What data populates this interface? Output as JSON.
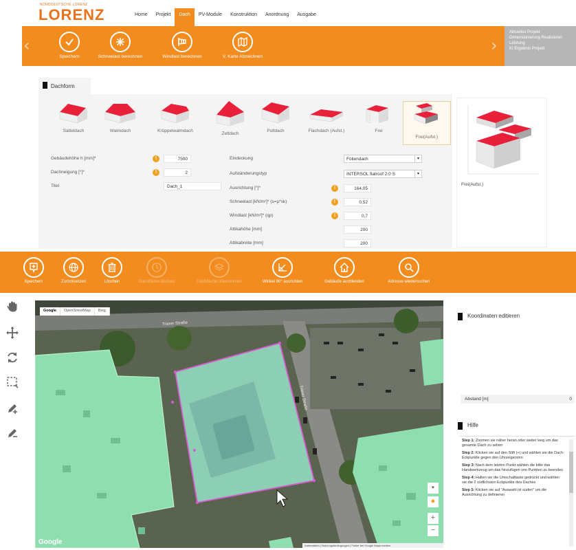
{
  "header": {
    "logo_small": "NORDDEUTSCHE LORENZ",
    "logo": "LORENZ",
    "nav": [
      {
        "label": "Home",
        "active": false
      },
      {
        "label": "Projekt",
        "active": false
      },
      {
        "label": "Dach",
        "active": true
      },
      {
        "label": "PV-Module",
        "active": false
      },
      {
        "label": "Konstruktion",
        "active": false
      },
      {
        "label": "Anordnung",
        "active": false
      },
      {
        "label": "Ausgabe",
        "active": false
      }
    ]
  },
  "top_toolbar": {
    "buttons": [
      {
        "label": "Speichern",
        "icon": "check-icon"
      },
      {
        "label": "Schneelast berechnen",
        "icon": "snowflake-icon"
      },
      {
        "label": "Windlast berechnen",
        "icon": "windsock-icon"
      },
      {
        "label": "V. Karte Abzeichnen",
        "icon": "map-icon"
      }
    ],
    "right_panel": [
      "Aktuelles Projekt",
      "Dimensionierung Realisieren",
      "Leistung",
      "KI Ergebnis Projekt"
    ]
  },
  "dachform": {
    "tab_label": "Dachform",
    "roof_types": [
      {
        "label": "Satteldach",
        "selected": false
      },
      {
        "label": "Walmdach",
        "selected": false
      },
      {
        "label": "Krüppelwalmdach",
        "selected": false
      },
      {
        "label": "Zeltdach",
        "selected": false
      },
      {
        "label": "Pultdach",
        "selected": false
      },
      {
        "label": "Flachdach (Aufst.)",
        "selected": false
      },
      {
        "label": "Frei",
        "selected": false
      },
      {
        "label": "Frei(Aufst.)",
        "selected": true
      }
    ],
    "left_fields": [
      {
        "label": "Gebäudehöhe h [mm]*",
        "value": "7500",
        "info": true
      },
      {
        "label": "Dachneigung [°]*",
        "value": "2",
        "info": true
      },
      {
        "label": "Titel",
        "value": "Dach_1",
        "info": false
      }
    ],
    "eindeckung": {
      "label": "Eindeckung",
      "value": "Foliendach"
    },
    "aufstaenderung": {
      "label": "Aufständerungstyp",
      "value": "INTERSOL flatroof 2.0 S"
    },
    "right_fields": [
      {
        "label": "Ausrichtung [°]*",
        "value": "164,05",
        "info": true
      },
      {
        "label": "Schneelast [kN/m²]* (s=µ*sk)",
        "value": "0,52",
        "info": true
      },
      {
        "label": "Windlast [kN/m²]* (qp)",
        "value": "0,7",
        "info": true
      },
      {
        "label": "Attikahöhe [mm]",
        "value": "200",
        "info": false
      },
      {
        "label": "Attikabreite [mm]",
        "value": "200",
        "info": false
      }
    ],
    "preview_label": "Frei(Aufst.)"
  },
  "bottom_toolbar": {
    "buttons": [
      {
        "label": "Speichern",
        "icon": "save-pin-icon",
        "disabled": false
      },
      {
        "label": "Zurücksetzen",
        "icon": "globe-icon",
        "disabled": false
      },
      {
        "label": "Löschen",
        "icon": "trash-icon",
        "disabled": false
      },
      {
        "label": "Dachfläche löschen",
        "icon": "clock-icon",
        "disabled": true
      },
      {
        "label": "Dachfläche übernehmen",
        "icon": "layers-icon",
        "disabled": true
      },
      {
        "label": "Winkel 90° ausrichten",
        "icon": "angle-icon",
        "disabled": false
      },
      {
        "label": "Gebäude ausblenden",
        "icon": "home-icon",
        "disabled": false
      },
      {
        "label": "Adresse wiedersuchen",
        "icon": "search-icon",
        "disabled": false
      }
    ]
  },
  "map": {
    "tabs": [
      {
        "label": "Google",
        "active": true
      },
      {
        "label": "OpenStreetMap",
        "active": false
      },
      {
        "label": "Bing",
        "active": false
      }
    ],
    "google_logo": "Google",
    "footer": "Kartendaten | Nutzungsbedingungen | Fehler bei Google Maps melden",
    "street_label": "Trierer Straße"
  },
  "side": {
    "koordinaten_title": "Koordinaten editieren",
    "abstand_label": "Abstand [m]",
    "abstand_value": "0",
    "hilfe_title": "Hilfe",
    "steps": [
      {
        "num": "Step 1:",
        "text": "Zoomen sie näher heran oder weiter weg um das gesamte Dach zu sehen"
      },
      {
        "num": "Step 2:",
        "text": "Klicken sie auf den Stift (+) und wählen sie die Dach-Eckpunkte gegen den Uhrzeigersinn"
      },
      {
        "num": "Step 3:",
        "text": "Nach dem letzten Punkt wählen die bitte das Handwerkzeug um das hinzufügen von Punkten zu beenden"
      },
      {
        "num": "Step 4:",
        "text": "Halten sie die Umschalttaste gedrückt und wählen sie die 2 südlichsten Eckpunkte des Daches"
      },
      {
        "num": "Step 5:",
        "text": "Klicken sie auf \"Auswahl ist süden\" um die Ausrichtung zu definieren"
      }
    ]
  },
  "colors": {
    "accent": "#f28c1e",
    "roof_red": "#e8203a",
    "map_overlay": "#8fe8b0"
  }
}
